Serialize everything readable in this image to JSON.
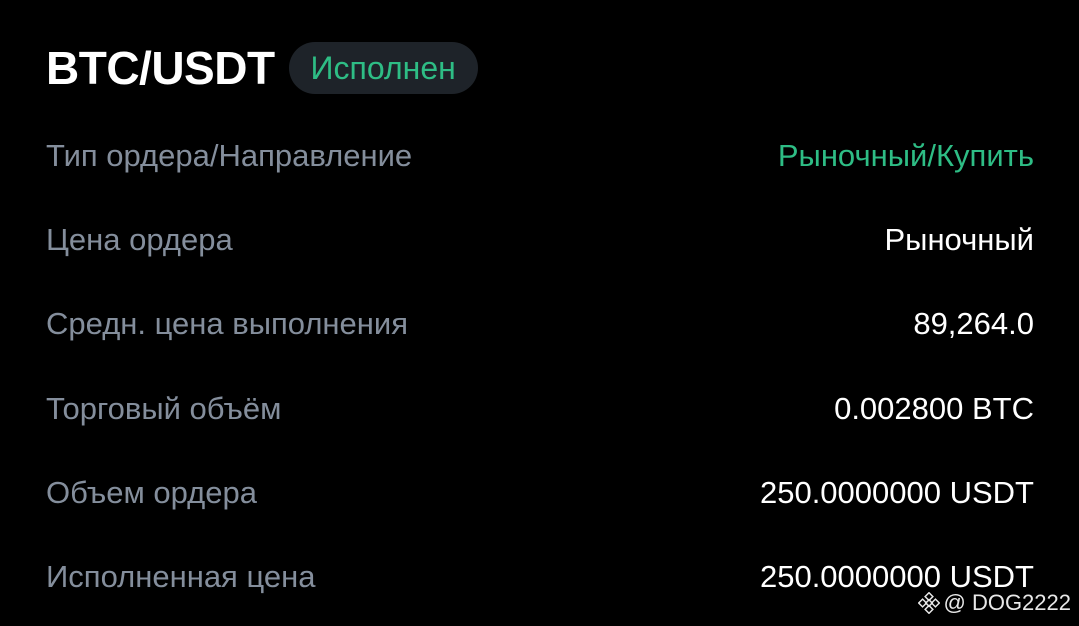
{
  "header": {
    "pair": "BTC/USDT",
    "status": "Исполнен"
  },
  "rows": [
    {
      "label": "Тип ордера/Направление",
      "value": "Рыночный/Купить",
      "value_color": "#2ebd85"
    },
    {
      "label": "Цена ордера",
      "value": "Рыночный"
    },
    {
      "label": "Средн. цена выполнения",
      "value": "89,264.0"
    },
    {
      "label": "Торговый объём",
      "value": "0.002800 BTC"
    },
    {
      "label": "Объем ордера",
      "value": "250.0000000 USDT"
    },
    {
      "label": "Исполненная цена",
      "value": "250.0000000 USDT"
    }
  ],
  "watermark": {
    "icon": "binance-logo-icon",
    "text": "@ DOG2222"
  },
  "colors": {
    "background": "#000000",
    "label": "#848e9c",
    "value": "#ffffff",
    "accent_green": "#2ebd85",
    "badge_bg": "#1e2329"
  }
}
